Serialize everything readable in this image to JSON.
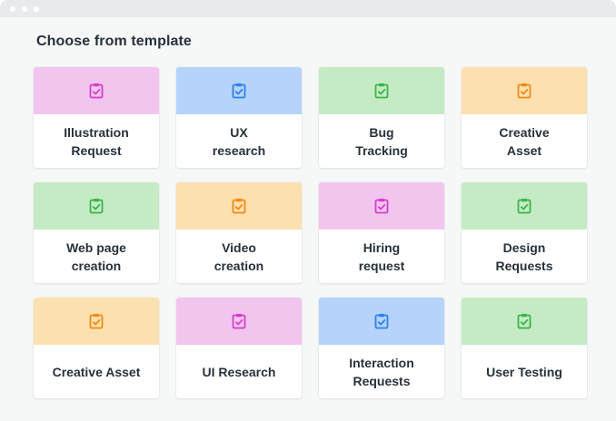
{
  "title": "Choose from template",
  "colors": {
    "pink": "#f2c5ef",
    "blue": "#b5d3fb",
    "green": "#c5ebc4",
    "orange": "#fde0b0",
    "pink_icon": "#d63ec9",
    "blue_icon": "#2f80ed",
    "green_icon": "#3cb44b",
    "orange_icon": "#f08a12"
  },
  "templates": [
    {
      "label": "Illustration\nRequest",
      "color": "pink",
      "icon": "clipboard-check-icon"
    },
    {
      "label": "UX\nresearch",
      "color": "blue",
      "icon": "clipboard-check-icon"
    },
    {
      "label": "Bug\nTracking",
      "color": "green",
      "icon": "clipboard-check-icon"
    },
    {
      "label": "Creative\nAsset",
      "color": "orange",
      "icon": "clipboard-check-icon"
    },
    {
      "label": "Web page\ncreation",
      "color": "green",
      "icon": "clipboard-check-icon"
    },
    {
      "label": "Video\ncreation",
      "color": "orange",
      "icon": "clipboard-check-icon"
    },
    {
      "label": "Hiring\nrequest",
      "color": "pink",
      "icon": "clipboard-check-icon"
    },
    {
      "label": "Design\nRequests",
      "color": "green",
      "icon": "clipboard-check-icon"
    },
    {
      "label": "Creative Asset",
      "color": "orange",
      "icon": "clipboard-check-icon"
    },
    {
      "label": "UI Research",
      "color": "pink",
      "icon": "clipboard-check-icon"
    },
    {
      "label": "Interaction\nRequests",
      "color": "blue",
      "icon": "clipboard-check-icon"
    },
    {
      "label": "User Testing",
      "color": "green",
      "icon": "clipboard-check-icon"
    }
  ]
}
